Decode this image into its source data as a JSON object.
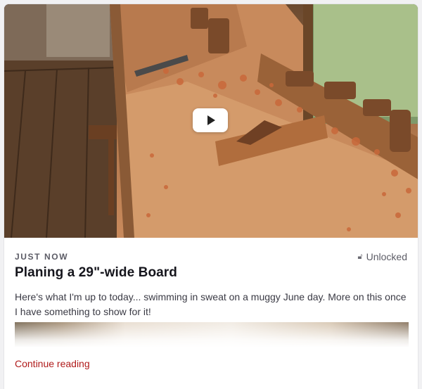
{
  "post": {
    "timestamp": "JUST NOW",
    "lock_status": "Unlocked",
    "title": "Planing a 29\"-wide Board",
    "excerpt": "Here's what I'm up to today... swimming in sweat on a muggy June day. More on this once I have something to show for it!",
    "continue_label": "Continue reading"
  },
  "icons": {
    "play": "play-icon",
    "lock": "unlocked-icon"
  },
  "colors": {
    "link": "#b01b1b",
    "title": "#15151c",
    "meta": "#5c5c66"
  }
}
